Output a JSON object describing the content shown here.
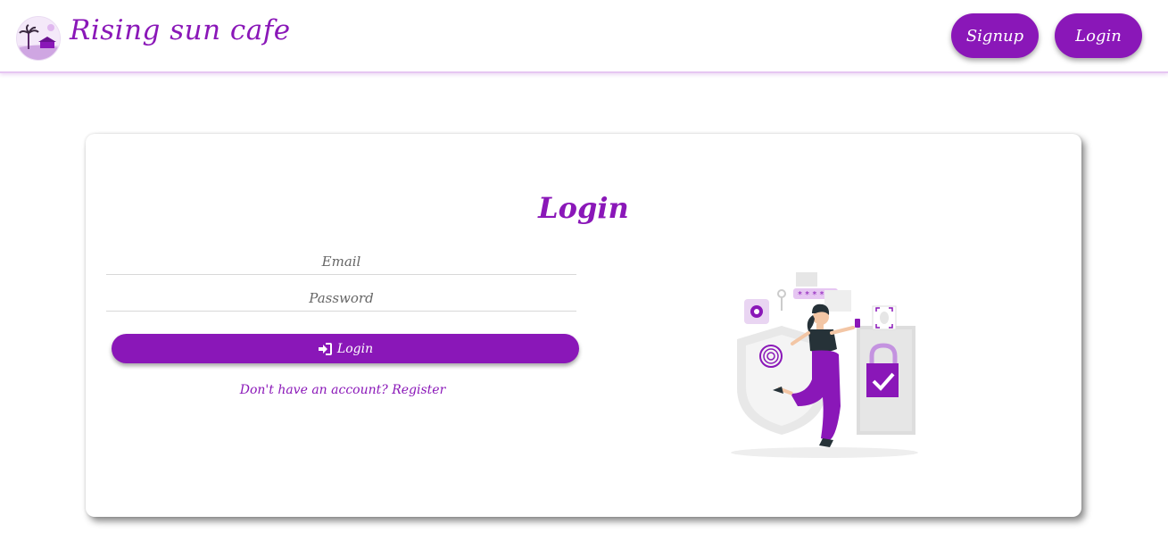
{
  "header": {
    "brand_name": "Rising sun cafe",
    "signup_label": "Signup",
    "login_label": "Login"
  },
  "login_card": {
    "title": "Login",
    "email_placeholder": "Email",
    "password_placeholder": "Password",
    "submit_label": "Login",
    "submit_icon": "sign-in-icon",
    "register_prompt": "Don't have an account?",
    "register_link": "Register"
  },
  "colors": {
    "accent": "#8a17b8",
    "header_border": "#e6c6f2",
    "card_background": "#ffffff"
  }
}
